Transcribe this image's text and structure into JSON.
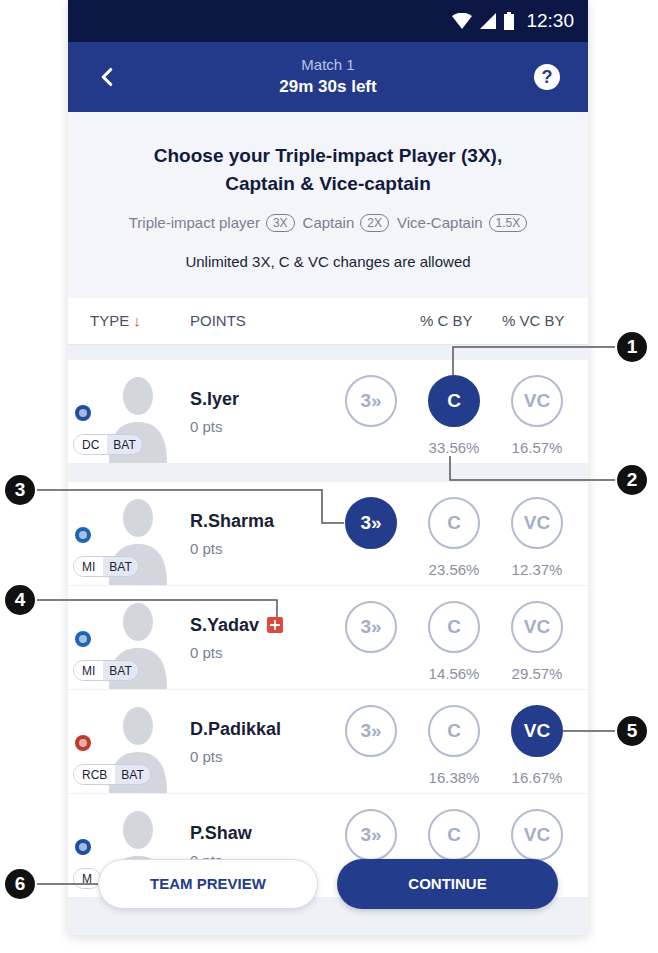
{
  "status_bar": {
    "time": "12:30"
  },
  "header": {
    "title": "Match 1",
    "subtitle": "29m 30s left",
    "help": "?"
  },
  "intro": {
    "title_lines": [
      "Choose your Triple-impact Player (3X),",
      "Captain & Vice-captain"
    ],
    "multipliers": [
      {
        "label": "Triple-impact player",
        "badge": "3X"
      },
      {
        "label": "Captain",
        "badge": "2X"
      },
      {
        "label": "Vice-Captain",
        "badge": "1.5X"
      }
    ],
    "note": "Unlimited 3X, C & VC changes are allowed"
  },
  "columns": [
    {
      "label": "TYPE",
      "sort_icon": "↓"
    },
    {
      "label": "POINTS"
    },
    {
      "label": "% C BY"
    },
    {
      "label": "% VC BY"
    }
  ],
  "players": [
    {
      "name": "S.Iyer",
      "team": "DC",
      "role": "BAT",
      "points": "0 pts",
      "injured": false,
      "color": "#1e4fa3",
      "choices": [
        {
          "label": "3»",
          "selected": false
        },
        {
          "label": "C",
          "selected": true,
          "percent": "33.56%"
        },
        {
          "label": "VC",
          "selected": false,
          "percent": "16.57%"
        }
      ]
    },
    {
      "name": "R.Sharma",
      "team": "MI",
      "role": "BAT",
      "points": "0 pts",
      "injured": false,
      "color": "#1f66b8",
      "choices": [
        {
          "label": "3»",
          "selected": true
        },
        {
          "label": "C",
          "selected": false,
          "percent": "23.56%"
        },
        {
          "label": "VC",
          "selected": false,
          "percent": "12.37%"
        }
      ]
    },
    {
      "name": "S.Yadav",
      "team": "MI",
      "role": "BAT",
      "points": "0 pts",
      "injured": true,
      "color": "#1f66b8",
      "choices": [
        {
          "label": "3»",
          "selected": false
        },
        {
          "label": "C",
          "selected": false,
          "percent": "14.56%"
        },
        {
          "label": "VC",
          "selected": false,
          "percent": "29.57%"
        }
      ]
    },
    {
      "name": "D.Padikkal",
      "team": "RCB",
      "role": "BAT",
      "points": "0 pts",
      "injured": false,
      "color": "#c0392b",
      "choices": [
        {
          "label": "3»",
          "selected": false
        },
        {
          "label": "C",
          "selected": false,
          "percent": "16.38%"
        },
        {
          "label": "VC",
          "selected": true,
          "percent": "16.67%"
        }
      ]
    },
    {
      "name": "P.Shaw",
      "team": "M",
      "points": "0 pts",
      "injured": false,
      "color": "#1e4fa3",
      "choices": [
        {
          "label": "3»",
          "selected": false
        },
        {
          "label": "C",
          "selected": false
        },
        {
          "label": "VC",
          "selected": false
        }
      ]
    }
  ],
  "buttons": {
    "team_preview": "TEAM PREVIEW",
    "continue": "CONTINUE"
  },
  "callouts": [
    "1",
    "2",
    "3",
    "4",
    "5",
    "6"
  ]
}
